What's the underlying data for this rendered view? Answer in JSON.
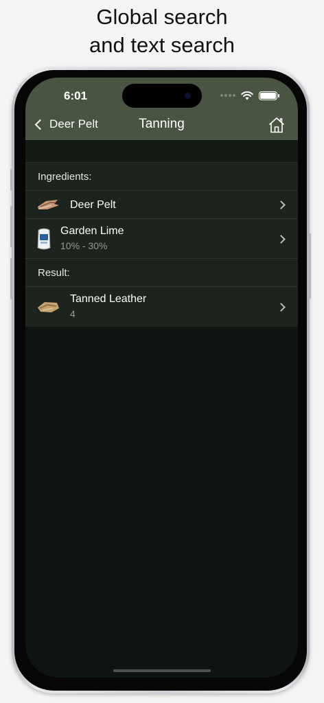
{
  "caption": {
    "line1": "Global search",
    "line2": "and text search"
  },
  "status_bar": {
    "time": "6:01"
  },
  "nav": {
    "back_label": "Deer Pelt",
    "title": "Tanning"
  },
  "sections": {
    "ingredients_label": "Ingredients:",
    "result_label": "Result:"
  },
  "ingredients": [
    {
      "title": "Deer Pelt",
      "subtitle": ""
    },
    {
      "title": "Garden Lime",
      "subtitle": "10% - 30%"
    }
  ],
  "result": {
    "title": "Tanned Leather",
    "subtitle": "4"
  },
  "icons": {
    "back": "chevron-left-icon",
    "home": "home-icon",
    "wifi": "wifi-icon",
    "battery": "battery-icon",
    "row_arrow": "chevron-right-icon"
  },
  "colors": {
    "nav_bar": "#4a5443",
    "background": "#0e140f",
    "list_group": "#1d241d",
    "secondary_text": "#959b91"
  }
}
